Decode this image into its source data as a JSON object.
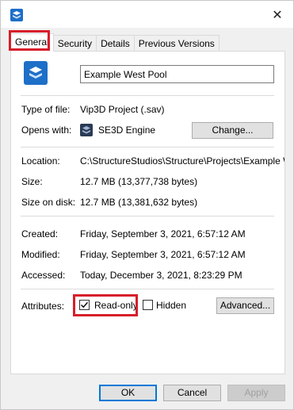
{
  "window": {
    "close_glyph": "✕"
  },
  "tabs": [
    {
      "label": "General",
      "active": true
    },
    {
      "label": "Security"
    },
    {
      "label": "Details"
    },
    {
      "label": "Previous Versions"
    }
  ],
  "file": {
    "name": "Example West Pool"
  },
  "info": {
    "type_label": "Type of file:",
    "type_value": "Vip3D Project (.sav)",
    "opens_label": "Opens with:",
    "opens_value": "SE3D Engine",
    "change_label": "Change...",
    "location_label": "Location:",
    "location_value": "C:\\StructureStudios\\Structure\\Projects\\Example We",
    "size_label": "Size:",
    "size_value": "12.7 MB (13,377,738 bytes)",
    "disk_label": "Size on disk:",
    "disk_value": "12.7 MB (13,381,632 bytes)",
    "created_label": "Created:",
    "created_value": "Friday, September 3, 2021, 6:57:12 AM",
    "modified_label": "Modified:",
    "modified_value": "Friday, September 3, 2021, 6:57:12 AM",
    "accessed_label": "Accessed:",
    "accessed_value": "Today, December 3, 2021, 8:23:29 PM"
  },
  "attributes": {
    "label": "Attributes:",
    "readonly_label": "Read-only",
    "readonly_checked": true,
    "hidden_label": "Hidden",
    "hidden_checked": false,
    "advanced_label": "Advanced..."
  },
  "footer": {
    "ok": "OK",
    "cancel": "Cancel",
    "apply": "Apply"
  },
  "colors": {
    "highlight": "#d81e2a",
    "icon_blue": "#1e6fc8",
    "engine_icon": "#2b3a55"
  },
  "icons": {
    "app": "vip3d-app-icon",
    "file": "vip3d-file-icon",
    "engine": "se3d-engine-icon"
  }
}
